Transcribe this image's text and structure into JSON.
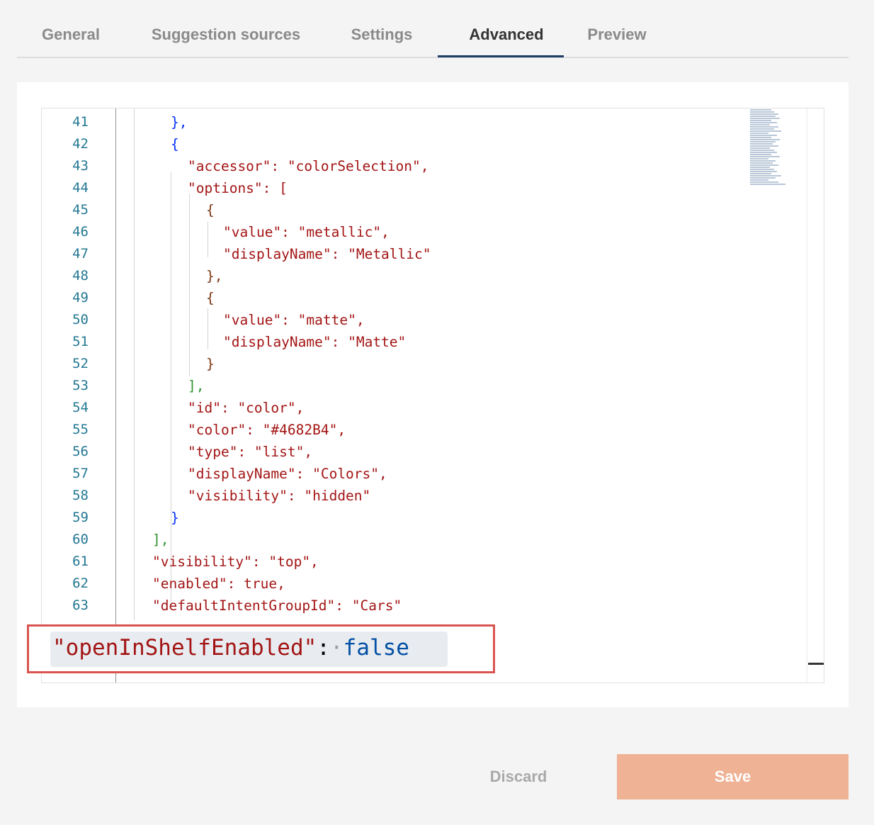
{
  "tabs": [
    {
      "label": "General"
    },
    {
      "label": "Suggestion sources"
    },
    {
      "label": "Settings"
    },
    {
      "label": "Advanced",
      "active": true
    },
    {
      "label": "Preview"
    }
  ],
  "editor": {
    "line_numbers": [
      "41",
      "42",
      "43",
      "44",
      "45",
      "46",
      "47",
      "48",
      "49",
      "50",
      "51",
      "52",
      "53",
      "54",
      "55",
      "56",
      "57",
      "58",
      "59",
      "60",
      "61",
      "62",
      "63"
    ],
    "lines": [
      "},",
      "{",
      "\"accessor\": \"colorSelection\",",
      "\"options\": [",
      "{",
      "\"value\": \"metallic\",",
      "\"displayName\": \"Metallic\"",
      "},",
      "{",
      "\"value\": \"matte\",",
      "\"displayName\": \"Matte\"",
      "}",
      "],",
      "\"id\": \"color\",",
      "\"color\": \"#4682B4\",",
      "\"type\": \"list\",",
      "\"displayName\": \"Colors\",",
      "\"visibility\": \"hidden\"",
      "}",
      "],",
      "\"visibility\": \"top\",",
      "\"enabled\": true,",
      "\"defaultIntentGroupId\": \"Cars\""
    ]
  },
  "callout": {
    "key": "\"openInShelfEnabled\"",
    "colon": ":",
    "value": "false"
  },
  "buttons": {
    "discard": "Discard",
    "save": "Save"
  },
  "colors": {
    "accent": "#1f3c66",
    "save_button": "#efb295",
    "callout_border": "#d9534f"
  }
}
